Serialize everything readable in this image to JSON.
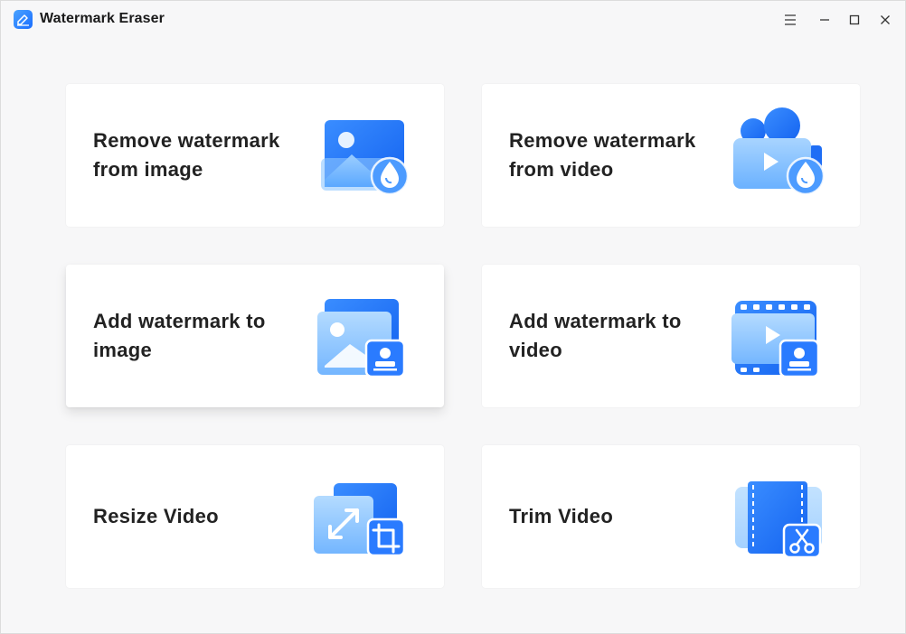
{
  "app": {
    "title": "Watermark Eraser",
    "icon": "app-logo-icon"
  },
  "titlebar": {
    "controls": [
      "menu-icon",
      "minimize-icon",
      "maximize-icon",
      "close-icon"
    ]
  },
  "colors": {
    "accent": "#1a6dff",
    "accent_light": "#8fc4ff",
    "background": "#f7f7f8",
    "card": "#ffffff"
  },
  "cards": [
    {
      "label_line1": "Remove watermark",
      "label_line2": "from image",
      "icon": "image-remove-watermark-icon"
    },
    {
      "label_line1": "Remove watermark",
      "label_line2": "from video",
      "icon": "video-remove-watermark-icon"
    },
    {
      "label_line1": "Add watermark to",
      "label_line2": "image",
      "icon": "image-add-watermark-icon"
    },
    {
      "label_line1": "Add watermark to",
      "label_line2": "video",
      "icon": "video-add-watermark-icon"
    },
    {
      "label_line1": "Resize Video",
      "icon": "resize-video-icon"
    },
    {
      "label_line1": "Trim Video",
      "icon": "trim-video-icon"
    }
  ]
}
